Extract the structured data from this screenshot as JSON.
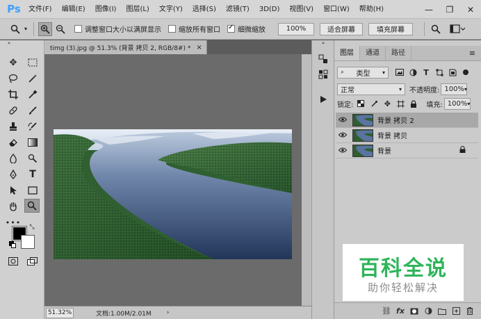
{
  "app": {
    "logo": "Ps"
  },
  "menu": [
    "文件(F)",
    "编辑(E)",
    "图像(I)",
    "图层(L)",
    "文字(Y)",
    "选择(S)",
    "滤镜(T)",
    "3D(D)",
    "视图(V)",
    "窗口(W)",
    "帮助(H)"
  ],
  "window_controls": {
    "minimize": "—",
    "restore": "❐",
    "close": "✕"
  },
  "options": {
    "resize_windows": "调整窗口大小以满屏显示",
    "zoom_all_windows": "缩放所有窗口",
    "scrubby_zoom": "细微缩放",
    "resize_checked": false,
    "zoom_all_checked": false,
    "scrubby_checked": true,
    "btn_100": "100%",
    "btn_fit": "适合屏幕",
    "btn_fill": "填充屏幕"
  },
  "document": {
    "tab_title": "timg (3).jpg @ 51.3% (背景 拷贝 2, RGB/8#) *",
    "close": "×",
    "zoom": "51.32%",
    "info": "文档:1.00M/2.01M",
    "arrow": "›"
  },
  "layers_panel": {
    "tabs": [
      "图层",
      "通道",
      "路径"
    ],
    "active_tab": 0,
    "filter_kind": "类型",
    "blend_mode": "正常",
    "opacity_label": "不透明度:",
    "opacity_value": "100%",
    "lock_label": "锁定:",
    "fill_label": "填充:",
    "fill_value": "100%",
    "layers": [
      {
        "name": "背景 拷贝 2",
        "selected": true,
        "locked": false
      },
      {
        "name": "背景 拷贝",
        "selected": false,
        "locked": false
      },
      {
        "name": "背景",
        "selected": false,
        "locked": true
      }
    ],
    "bottom_fx": "fx"
  },
  "watermark": {
    "title": "百科全说",
    "subtitle": "助你轻松解决"
  },
  "colors": {
    "foreground": "#000000",
    "background": "#ffffff",
    "watermark_green": "#2fb45a"
  }
}
